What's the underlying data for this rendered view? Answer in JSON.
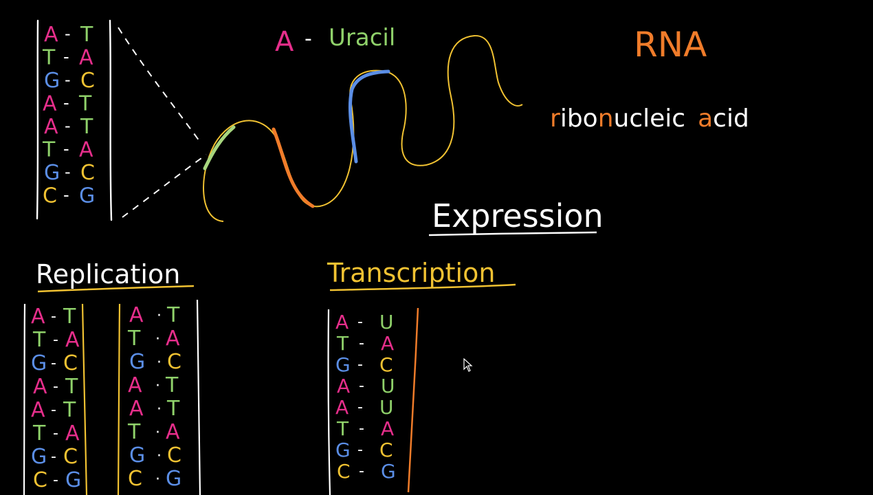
{
  "colors": {
    "A": "#e62e8b",
    "T": "#8fd16a",
    "G": "#5b8ee6",
    "C": "#f1c232",
    "U": "#8fd16a",
    "chalk": "#ffffff",
    "orange": "#f07c2a",
    "yellow": "#f1c232",
    "blue": "#5b8ee6",
    "green": "#a7d67e",
    "background": "#000000"
  },
  "dash": "-",
  "dot": "·",
  "header": {
    "a": "A",
    "uracil": "Uracil",
    "rna": "RNA",
    "ribonucleic": {
      "r": "r",
      "ibo": "ibo",
      "n": "n",
      "ucleic": "ucleic",
      "a": "a",
      "cid": "cid"
    },
    "expression": "Expression"
  },
  "dna_pairs": [
    {
      "left": "A",
      "right": "T"
    },
    {
      "left": "T",
      "right": "A"
    },
    {
      "left": "G",
      "right": "C"
    },
    {
      "left": "A",
      "right": "T"
    },
    {
      "left": "A",
      "right": "T"
    },
    {
      "left": "T",
      "right": "A"
    },
    {
      "left": "G",
      "right": "C"
    },
    {
      "left": "C",
      "right": "G"
    }
  ],
  "replication": {
    "title": "Replication",
    "left_pairs": [
      {
        "left": "A",
        "right": "T"
      },
      {
        "left": "T",
        "right": "A"
      },
      {
        "left": "G",
        "right": "C"
      },
      {
        "left": "A",
        "right": "T"
      },
      {
        "left": "A",
        "right": "T"
      },
      {
        "left": "T",
        "right": "A"
      },
      {
        "left": "G",
        "right": "C"
      },
      {
        "left": "C",
        "right": "G"
      }
    ],
    "right_pairs": [
      {
        "left": "A",
        "right": "T"
      },
      {
        "left": "T",
        "right": "A"
      },
      {
        "left": "G",
        "right": "C"
      },
      {
        "left": "A",
        "right": "T"
      },
      {
        "left": "A",
        "right": "T"
      },
      {
        "left": "T",
        "right": "A"
      },
      {
        "left": "G",
        "right": "C"
      },
      {
        "left": "C",
        "right": "G"
      }
    ]
  },
  "transcription": {
    "title": "Transcription",
    "pairs": [
      {
        "left": "A",
        "right": "U"
      },
      {
        "left": "T",
        "right": "A"
      },
      {
        "left": "G",
        "right": "C"
      },
      {
        "left": "A",
        "right": "U"
      },
      {
        "left": "A",
        "right": "U"
      },
      {
        "left": "T",
        "right": "A"
      },
      {
        "left": "G",
        "right": "C"
      },
      {
        "left": "C",
        "right": "G"
      }
    ]
  }
}
